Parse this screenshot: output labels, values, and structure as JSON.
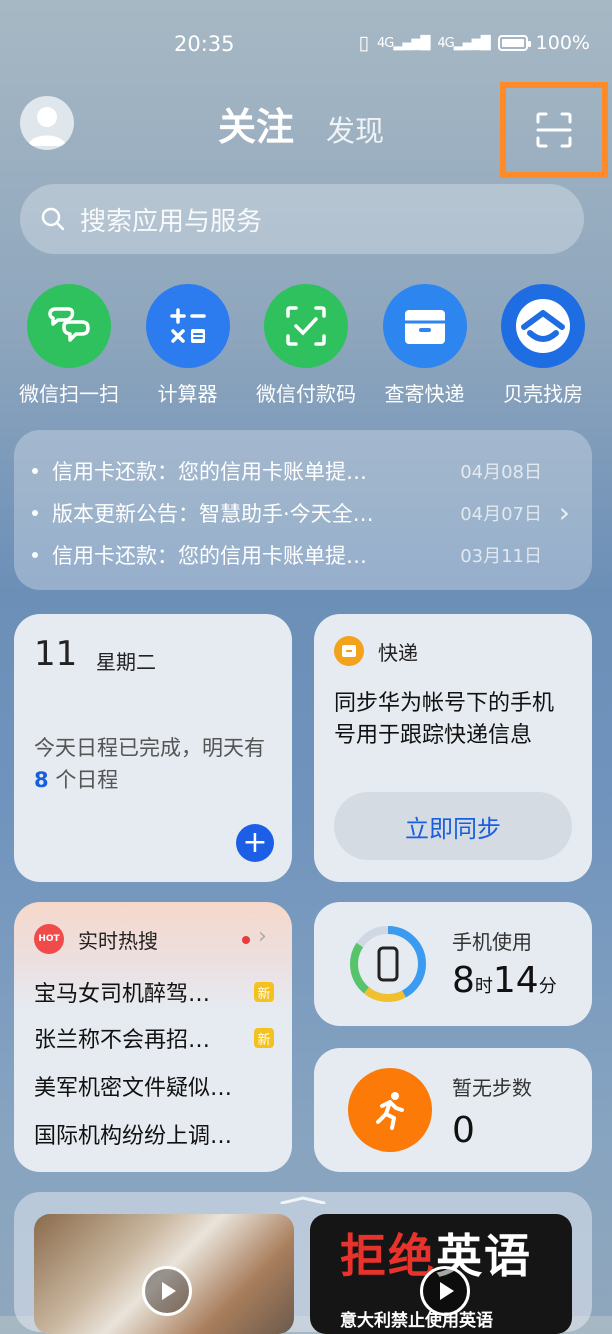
{
  "status": {
    "time": "20:35",
    "battery": "100%"
  },
  "header": {
    "tab_active": "关注",
    "tab_other": "发现"
  },
  "search": {
    "placeholder": "搜索应用与服务"
  },
  "apps": [
    {
      "label": "微信扫一扫",
      "icon": "wechat-scan-icon",
      "color": "#2fc15d"
    },
    {
      "label": "计算器",
      "icon": "calculator-icon",
      "color": "#2c7cf0"
    },
    {
      "label": "微信付款码",
      "icon": "wechat-pay-code-icon",
      "color": "#2fc15d"
    },
    {
      "label": "查寄快递",
      "icon": "package-icon",
      "color": "#2d85f0"
    },
    {
      "label": "贝壳找房",
      "icon": "beike-house-icon",
      "color": "#1f6de3"
    }
  ],
  "notices": [
    {
      "text": "信用卡还款：您的信用卡账单提…",
      "date": "04月08日"
    },
    {
      "text": "版本更新公告：智慧助手·今天全…",
      "date": "04月07日"
    },
    {
      "text": "信用卡还款：您的信用卡账单提…",
      "date": "03月11日"
    }
  ],
  "calendar": {
    "day": "11",
    "weekday": "星期二",
    "desc_before": "今天日程已完成，明天有",
    "count": "8",
    "desc_after": "个日程"
  },
  "express": {
    "title": "快递",
    "text": "同步华为帐号下的手机号用于跟踪快递信息",
    "button": "立即同步"
  },
  "hot": {
    "title": "实时热搜",
    "icon_text": "HOT",
    "items": [
      {
        "text": "宝马女司机醉驾…",
        "badge": "新"
      },
      {
        "text": "张兰称不会再招…",
        "badge": "新"
      },
      {
        "text": "美军机密文件疑似…",
        "badge": ""
      },
      {
        "text": "国际机构纷纷上调…",
        "badge": ""
      }
    ]
  },
  "usage": {
    "label": "手机使用",
    "hours": "8",
    "hours_unit": "时",
    "minutes": "14",
    "minutes_unit": "分"
  },
  "steps": {
    "label": "暂无步数",
    "value": "0"
  },
  "videos": {
    "v2_title_red": "拒绝",
    "v2_title_white": "英语",
    "v2_subtitle": "意大利禁止使用英语"
  }
}
